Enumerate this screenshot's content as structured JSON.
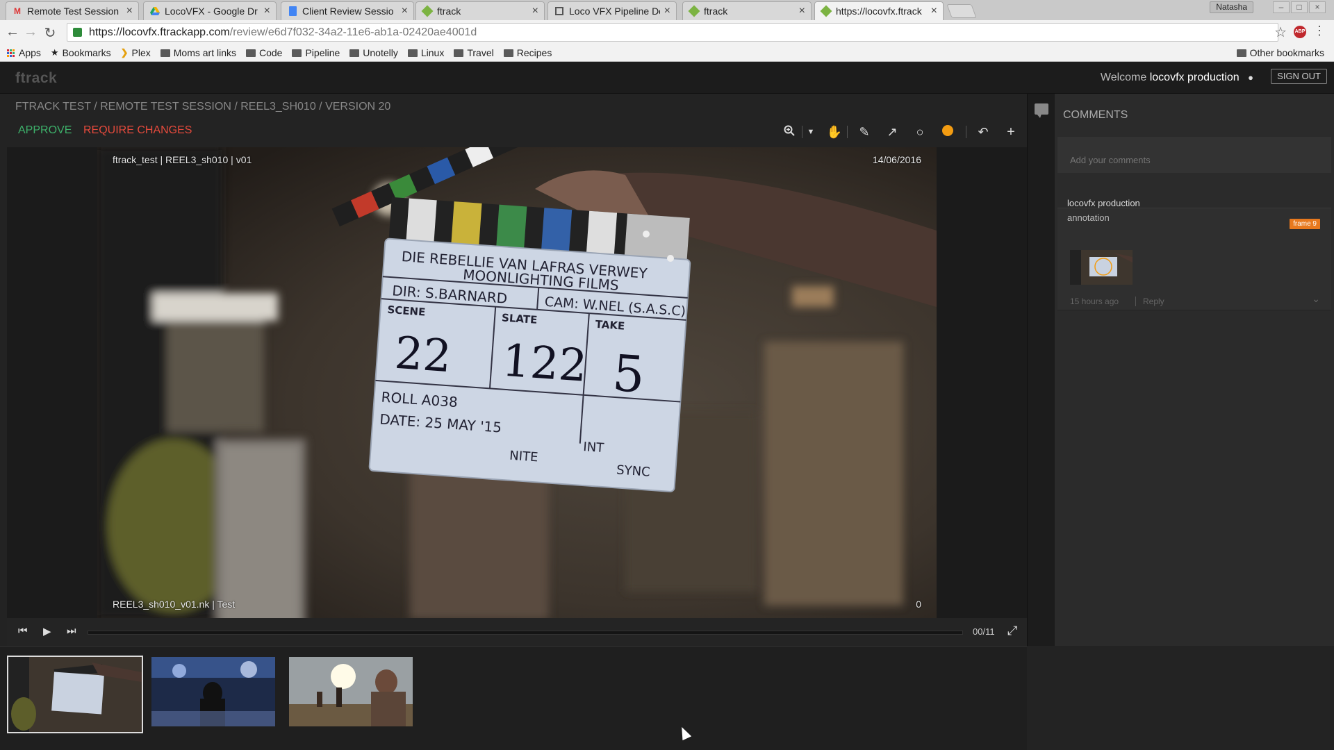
{
  "browser": {
    "tabs": [
      {
        "title": "Remote Test Session",
        "icon": "gmail-icon",
        "active": false
      },
      {
        "title": "LocoVFX - Google Dr",
        "icon": "google-drive-icon",
        "active": false
      },
      {
        "title": "Client Review Sessio",
        "icon": "google-docs-icon",
        "active": false
      },
      {
        "title": "ftrack",
        "icon": "ftrack-icon",
        "active": false
      },
      {
        "title": "Loco VFX Pipeline Do",
        "icon": "confluence-icon",
        "active": false
      },
      {
        "title": "ftrack",
        "icon": "ftrack-icon",
        "active": false
      },
      {
        "title": "https://locovfx.ftrack",
        "icon": "ftrack-icon",
        "active": true
      }
    ],
    "profile_name": "Natasha",
    "url_host": "https://locovfx.ftrackapp.com",
    "url_path": "/review/e6d7f032-34a2-11e6-ab1a-02420ae4001d",
    "bookmarks": [
      {
        "label": "Apps",
        "type": "apps"
      },
      {
        "label": "Bookmarks",
        "type": "star"
      },
      {
        "label": "Plex",
        "type": "plex"
      },
      {
        "label": "Moms art links",
        "type": "folder"
      },
      {
        "label": "Code",
        "type": "folder"
      },
      {
        "label": "Pipeline",
        "type": "folder"
      },
      {
        "label": "Unotelly",
        "type": "folder"
      },
      {
        "label": "Linux",
        "type": "folder"
      },
      {
        "label": "Travel",
        "type": "folder"
      },
      {
        "label": "Recipes",
        "type": "folder"
      }
    ],
    "other_bookmarks": "Other bookmarks"
  },
  "app": {
    "logo": "ftrack",
    "welcome_prefix": "Welcome",
    "user_name": "locovfx production",
    "sign_out": "SIGN OUT",
    "breadcrumb": "FTRACK TEST / REMOTE TEST SESSION / REEL3_SH010 / VERSION 20",
    "approve": "APPROVE",
    "require_changes": "REQUIRE CHANGES",
    "annotation_color": "#f39c12"
  },
  "viewer": {
    "top_left": "ftrack_test  |  REEL3_sh010 | v01",
    "top_right": "14/06/2016",
    "bottom_left": "REEL3_sh010_v01.nk  |  Test",
    "bottom_right": "0",
    "frame_counter": "00/11",
    "slate": {
      "production": "DIE REBELLIE VAN LAFRAS VERWEY",
      "company": "MOONLIGHTING FILMS",
      "director": "DIR: S.BARNARD",
      "camera": "CAM: W.NEL (S.A.S.C)",
      "scene_label": "SCENE",
      "scene": "22",
      "slate_label": "SLATE",
      "slate": "122",
      "take_label": "TAKE",
      "take": "5",
      "roll": "ROLL A038",
      "date": "DATE: 25 MAY '15",
      "nite": "NITE",
      "int": "INT",
      "sync": "SYNC"
    }
  },
  "comments": {
    "title": "COMMENTS",
    "input_placeholder": "Add your comments",
    "items": [
      {
        "author": "locovfx production",
        "frame_badge": "frame 9",
        "body": "annotation",
        "time": "15 hours ago",
        "reply": "Reply"
      }
    ]
  }
}
